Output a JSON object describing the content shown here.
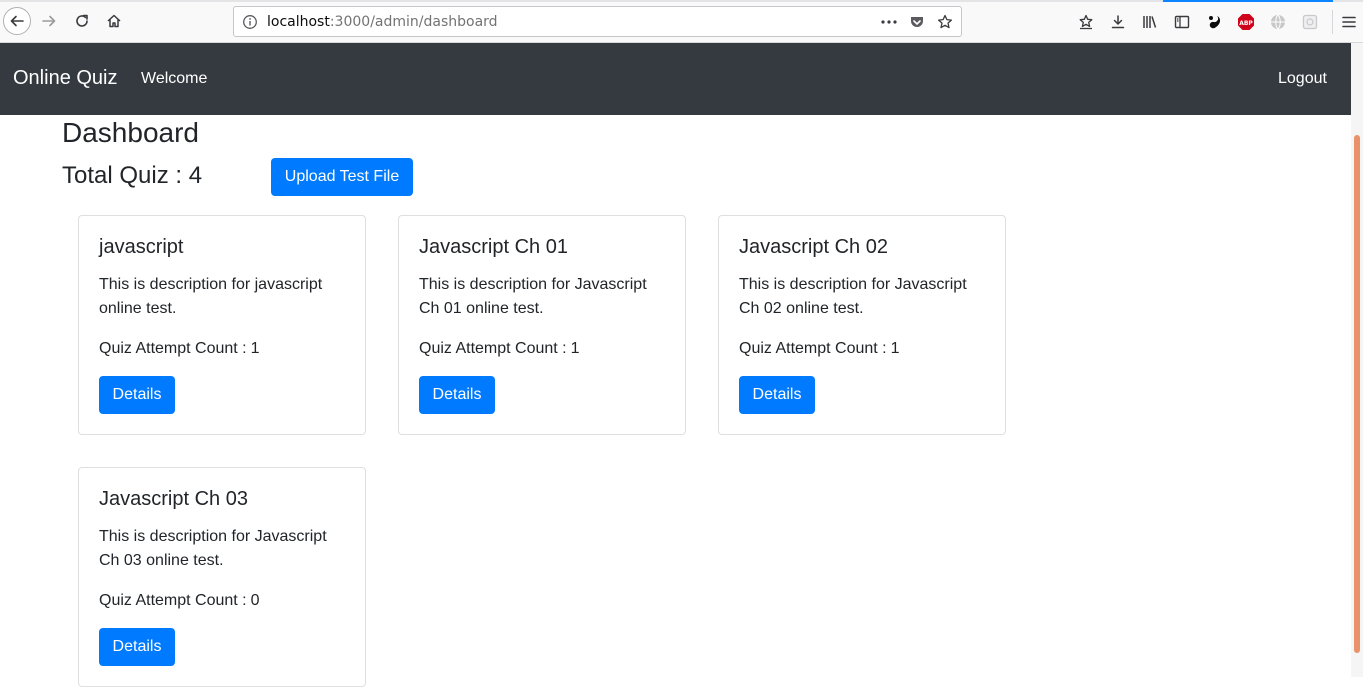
{
  "browser": {
    "url_host": "localhost",
    "url_path": ":3000/admin/dashboard",
    "accent_color": "#0a84ff"
  },
  "navbar": {
    "brand": "Online Quiz",
    "welcome": "Welcome",
    "logout": "Logout",
    "bg_color": "#343a40"
  },
  "dashboard": {
    "title": "Dashboard",
    "total_label": "Total Quiz : 4",
    "upload_button": "Upload Test File",
    "button_color": "#007bff"
  },
  "quizzes": [
    {
      "title": "javascript",
      "description": "This is description for javascript online test.",
      "attempt_label": "Quiz Attempt Count :",
      "attempt_count": "1",
      "details_label": "Details"
    },
    {
      "title": "Javascript Ch 01",
      "description": "This is description for Javascript Ch 01 online test.",
      "attempt_label": "Quiz Attempt Count :",
      "attempt_count": "1",
      "details_label": "Details"
    },
    {
      "title": "Javascript Ch 02",
      "description": "This is description for Javascript Ch 02 online test.",
      "attempt_label": "Quiz Attempt Count :",
      "attempt_count": "1",
      "details_label": "Details"
    },
    {
      "title": "Javascript Ch 03",
      "description": "This is description for Javascript Ch 03 online test.",
      "attempt_label": "Quiz Attempt Count :",
      "attempt_count": "0",
      "details_label": "Details"
    }
  ]
}
